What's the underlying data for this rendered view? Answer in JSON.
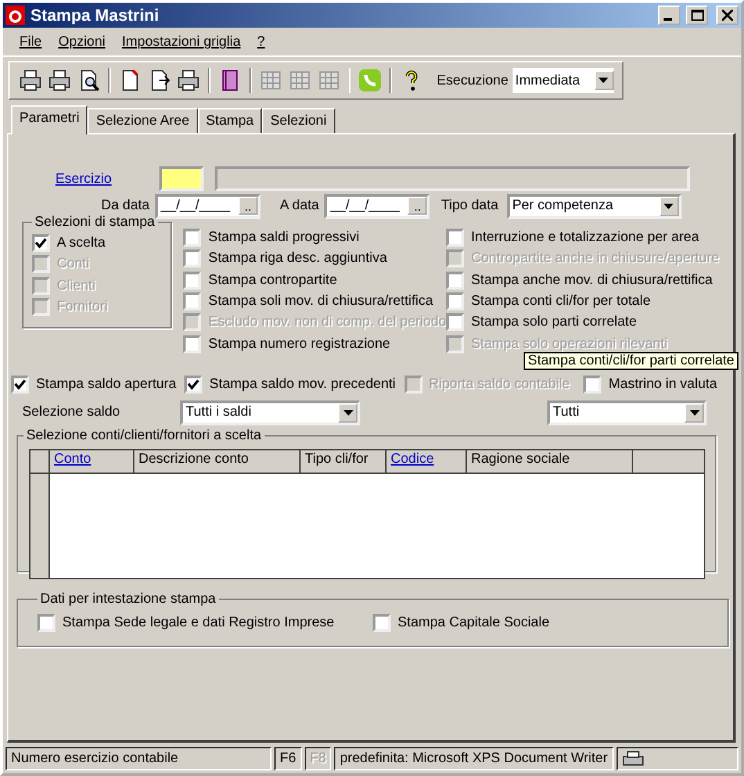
{
  "window": {
    "title": "Stampa Mastrini"
  },
  "menu": [
    {
      "label": "File"
    },
    {
      "label": "Opzioni"
    },
    {
      "label": "Impostazioni griglia"
    },
    {
      "label": "?"
    }
  ],
  "toolbar": {
    "execution_label": "Esecuzione",
    "execution_value": "Immediata"
  },
  "tabs": [
    {
      "label": "Parametri",
      "selected": true
    },
    {
      "label": "Selezione Aree",
      "selected": false
    },
    {
      "label": "Stampa",
      "selected": false
    },
    {
      "label": "Selezioni",
      "selected": false
    }
  ],
  "esercizio": {
    "label": "Esercizio"
  },
  "da_data": {
    "label": "Da data",
    "value": "__/__/____",
    "button": ".."
  },
  "a_data": {
    "label": "A data",
    "value": "__/__/____",
    "button": ".."
  },
  "tipo_data": {
    "label": "Tipo data",
    "value": "Per competenza"
  },
  "selezioni_di_stampa": {
    "title": "Selezioni di stampa",
    "options": [
      {
        "label": "A scelta",
        "checked": true,
        "disabled": false
      },
      {
        "label": "Conti",
        "checked": false,
        "disabled": true
      },
      {
        "label": "Clienti",
        "checked": false,
        "disabled": true
      },
      {
        "label": "Fornitori",
        "checked": false,
        "disabled": true
      }
    ]
  },
  "options_left": [
    {
      "label": "Stampa saldi progressivi",
      "checked": false,
      "disabled": false
    },
    {
      "label": "Stampa riga desc. aggiuntiva",
      "checked": false,
      "disabled": false
    },
    {
      "label": "Stampa contropartite",
      "checked": false,
      "disabled": false
    },
    {
      "label": "Stampa soli mov. di chiusura/rettifica",
      "checked": false,
      "disabled": false
    },
    {
      "label": "Escludo mov. non di comp. del periodo",
      "checked": false,
      "disabled": true
    },
    {
      "label": "Stampa numero registrazione",
      "checked": false,
      "disabled": false
    }
  ],
  "options_right": [
    {
      "label": "Interruzione e totalizzazione per area",
      "checked": false,
      "disabled": false
    },
    {
      "label": "Contropartite anche in chiusure/aperture",
      "checked": false,
      "disabled": true
    },
    {
      "label": "Stampa anche mov. di chiusura/rettifica",
      "checked": false,
      "disabled": false
    },
    {
      "label": "Stampa conti cli/for per totale",
      "checked": false,
      "disabled": false
    },
    {
      "label": "Stampa solo parti correlate",
      "checked": false,
      "disabled": false
    },
    {
      "label": "Stampa solo operazioni rilevanti",
      "checked": false,
      "disabled": true
    }
  ],
  "options_row": [
    {
      "label": "Stampa saldo apertura",
      "checked": true,
      "disabled": false
    },
    {
      "label": "Stampa saldo mov. precedenti",
      "checked": true,
      "disabled": false
    },
    {
      "label": "Riporta saldo contabile",
      "checked": false,
      "disabled": true
    },
    {
      "label": "Mastrino in valuta",
      "checked": false,
      "disabled": false
    }
  ],
  "tooltip": "Stampa conti/cli/for parti correlate",
  "selezione_saldo": {
    "label": "Selezione saldo",
    "value": "Tutti i saldi"
  },
  "filter_combo": {
    "value": "Tutti"
  },
  "grid": {
    "title": "Selezione conti/clienti/fornitori a scelta",
    "columns": [
      {
        "label": "Conto",
        "link": true
      },
      {
        "label": "Descrizione conto",
        "link": false
      },
      {
        "label": "Tipo cli/for",
        "link": false
      },
      {
        "label": "Codice",
        "link": true
      },
      {
        "label": "Ragione sociale",
        "link": false
      }
    ]
  },
  "intestazione": {
    "title": "Dati per intestazione stampa",
    "options": [
      {
        "label": "Stampa Sede legale e dati Registro Imprese",
        "checked": false,
        "disabled": false
      },
      {
        "label": "Stampa Capitale Sociale",
        "checked": false,
        "disabled": false
      }
    ]
  },
  "status_bar": {
    "message": "Numero esercizio contabile",
    "keys": [
      {
        "label": "F6",
        "disabled": false
      },
      {
        "label": "F8",
        "disabled": true
      }
    ],
    "printer": "predefinita: Microsoft XPS Document Writer"
  }
}
